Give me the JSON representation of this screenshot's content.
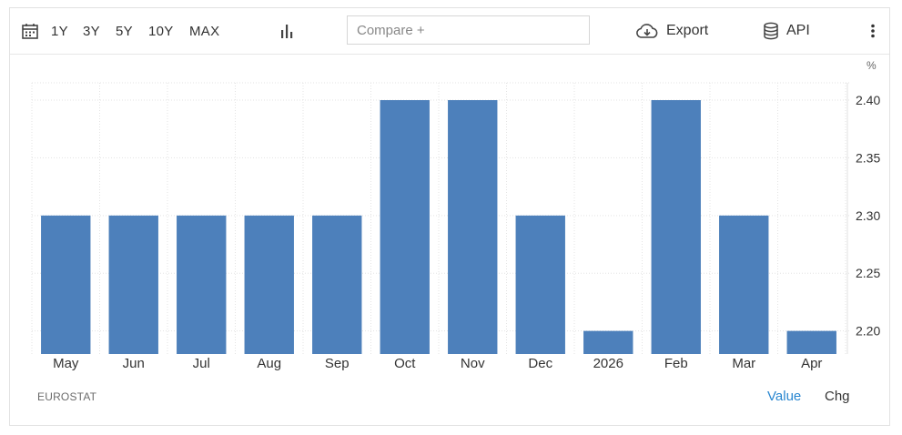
{
  "toolbar": {
    "calendar_icon": "calendar-icon",
    "ranges": [
      "1Y",
      "3Y",
      "5Y",
      "10Y",
      "MAX"
    ],
    "chart_type_icon": "bar-chart-icon",
    "compare_placeholder": "Compare +",
    "export_icon": "cloud-download-icon",
    "export_label": "Export",
    "api_icon": "database-icon",
    "api_label": "API",
    "menu_icon": "vertical-dots-icon"
  },
  "footer": {
    "source": "EUROSTAT",
    "value_label": "Value",
    "chg_label": "Chg"
  },
  "colors": {
    "bar": "#4d80bb",
    "active_toggle": "#2a87d0",
    "grid": "#e3e3e3"
  },
  "chart_data": {
    "type": "bar",
    "unit_label": "%",
    "categories": [
      "May",
      "Jun",
      "Jul",
      "Aug",
      "Sep",
      "Oct",
      "Nov",
      "Dec",
      "2026",
      "Feb",
      "Mar",
      "Apr"
    ],
    "values": [
      2.3,
      2.3,
      2.3,
      2.3,
      2.3,
      2.4,
      2.4,
      2.3,
      2.2,
      2.4,
      2.3,
      2.2
    ],
    "y_ticks": [
      "2.20",
      "2.25",
      "2.30",
      "2.35",
      "2.40"
    ],
    "ylim": [
      2.18,
      2.415
    ],
    "grid": true,
    "y_axis_side": "right"
  }
}
